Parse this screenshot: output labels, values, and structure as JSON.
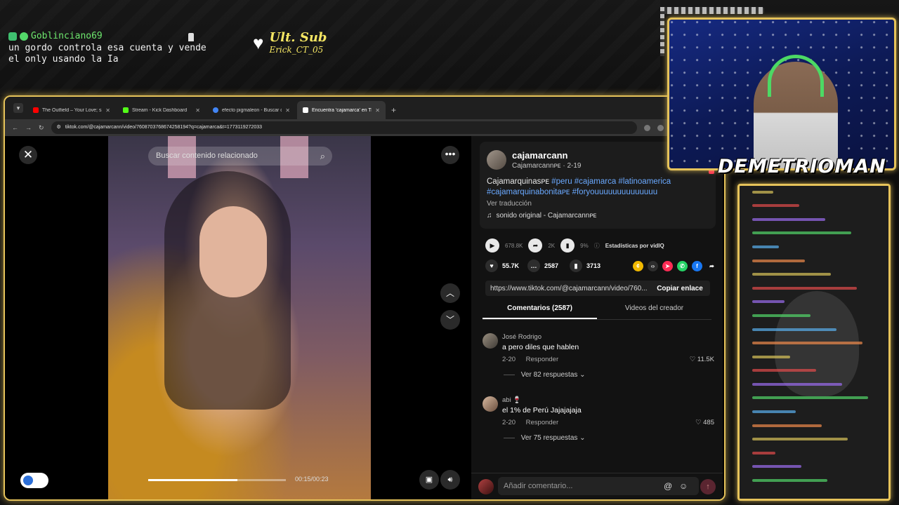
{
  "overlay": {
    "chat_user": "Goblinciano69",
    "chat_message": "un gordo controla esa cuenta y vende el only usando la Ia",
    "ult_sub_label": "Ult. Sub",
    "ult_sub_name": "Erick_CT_05",
    "streamer_name": "DEMETRIOMAN"
  },
  "browser": {
    "tabs": [
      {
        "title": "The Outfield – Your Love; si",
        "color": "#ff0000",
        "active": false
      },
      {
        "title": "Stream - Kick Dashboard",
        "color": "#53fc18",
        "active": false
      },
      {
        "title": "efecto pigmaleon - Buscar con",
        "color": "#4285f4",
        "active": false
      },
      {
        "title": "Encuentra 'cajamarca' en Ti",
        "color": "#ffffff",
        "active": true
      }
    ],
    "url": "tiktok.com/@cajamarcann/video/7608703768674258194?q=cajamarca&t=1773119272033"
  },
  "video": {
    "search_placeholder": "Buscar contenido relacionado",
    "time": "00:15/00:23",
    "progress": 0.65
  },
  "creator": {
    "username": "cajamarcann",
    "subline": "Cajamarcannᴘᴇ · 2-19",
    "desc_plain": "Cajamarquinasᴘᴇ",
    "tags": "#peru #cajamarca #latinoamerica #cajamarquinabonitaᴘᴇ #foryouuuuuuuuuuuuuu",
    "translate": "Ver traducción",
    "sound": "sonido original - Cajamarcannᴘᴇ"
  },
  "stats": {
    "views": "678.8K",
    "shares_small": "2K",
    "pct": "9%",
    "vidiq": "Estadísticas por vidIQ",
    "likes": "55.7K",
    "comments": "2587",
    "saves": "3713"
  },
  "share_icons": [
    "tiktok-coin-icon",
    "embed-icon",
    "send-icon",
    "whatsapp-icon",
    "facebook-icon",
    "share-arrow-icon"
  ],
  "link": {
    "url": "https://www.tiktok.com/@cajamarcann/video/760...",
    "copy_label": "Copiar enlace"
  },
  "tabs2": {
    "comments": "Comentarios (2587)",
    "creator_videos": "Videos del creador"
  },
  "comments": [
    {
      "name": "José Rodrigo",
      "text": "a pero diles que hablen",
      "date": "2-20",
      "reply": "Responder",
      "likes": "11.5K",
      "replies": "Ver 82 respuestas"
    },
    {
      "name": "abi 🍷",
      "text": "el 1% de Perú Jajajajaja",
      "date": "2-20",
      "reply": "Responder",
      "likes": "485",
      "replies": "Ver 75 respuestas"
    }
  ],
  "add_comment_placeholder": "Añadir comentario...",
  "colors": {
    "accent_gold": "#e6c35a",
    "tiktok_red": "#fe2c55",
    "hashtag_blue": "#6aa9ff",
    "overlay_green": "#6ee86e",
    "sub_yellow": "#f5e663"
  }
}
